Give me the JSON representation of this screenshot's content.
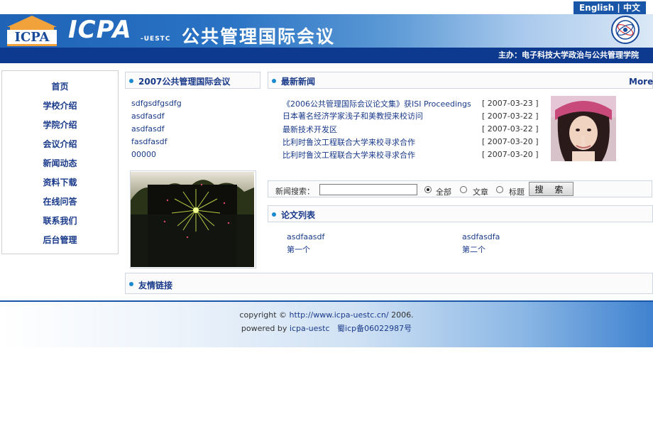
{
  "header": {
    "lang_english": "English",
    "lang_sep": "|",
    "lang_chinese": "中文",
    "logo_text": "ICPA",
    "brand": "ICPA",
    "brand_sub": "-UESTC",
    "title": "公共管理国际会议",
    "organizer": "主办：电子科技大学政治与公共管理学院"
  },
  "nav": {
    "items": [
      "首页",
      "学校介绍",
      "学院介绍",
      "会议介绍",
      "新闻动态",
      "资料下载",
      "在线问答",
      "联系我们",
      "后台管理"
    ]
  },
  "conference": {
    "title": "2007公共管理国际会议",
    "links": [
      "sdfgsdfgsdfg",
      "asdfasdf",
      "asdfasdf",
      "fasdfasdf",
      "00000"
    ]
  },
  "news": {
    "title": "最新新闻",
    "more": "More",
    "items": [
      {
        "title": "《2006公共管理国际会议论文集》获ISI Proceedings",
        "date": "[ 2007-03-23 ]"
      },
      {
        "title": "日本著名经济学家浅子和美教授来校访问",
        "date": "[ 2007-03-22 ]"
      },
      {
        "title": "最新技术开发区",
        "date": "[ 2007-03-22 ]"
      },
      {
        "title": "比利时鲁汶工程联合大学来校寻求合作",
        "date": "[ 2007-03-20 ]"
      },
      {
        "title": "比利时鲁汶工程联合大学来校寻求合作",
        "date": "[ 2007-03-20 ]"
      }
    ]
  },
  "search": {
    "label": "新闻搜索：",
    "value": "",
    "options": [
      "全部",
      "文章",
      "标题"
    ],
    "selected": "全部",
    "button": "搜 索"
  },
  "papers": {
    "title": "论文列表",
    "items": [
      "asdfaasdf",
      "asdfasdfa",
      "第一个",
      "第二个"
    ]
  },
  "links_section": {
    "title": "友情链接"
  },
  "footer": {
    "copyright_prefix": "copyright ©",
    "url": "http://www.icpa-uestc.cn/",
    "year": "2006.",
    "powered_prefix": "powered by",
    "powered_by": "icpa-uestc",
    "icp": "蜀icp备06022987号"
  },
  "colors": {
    "banner": "#1f63b6",
    "org_bar": "#0d3a8f",
    "link": "#1a3a8a",
    "bullet": "#1a8ad0"
  }
}
